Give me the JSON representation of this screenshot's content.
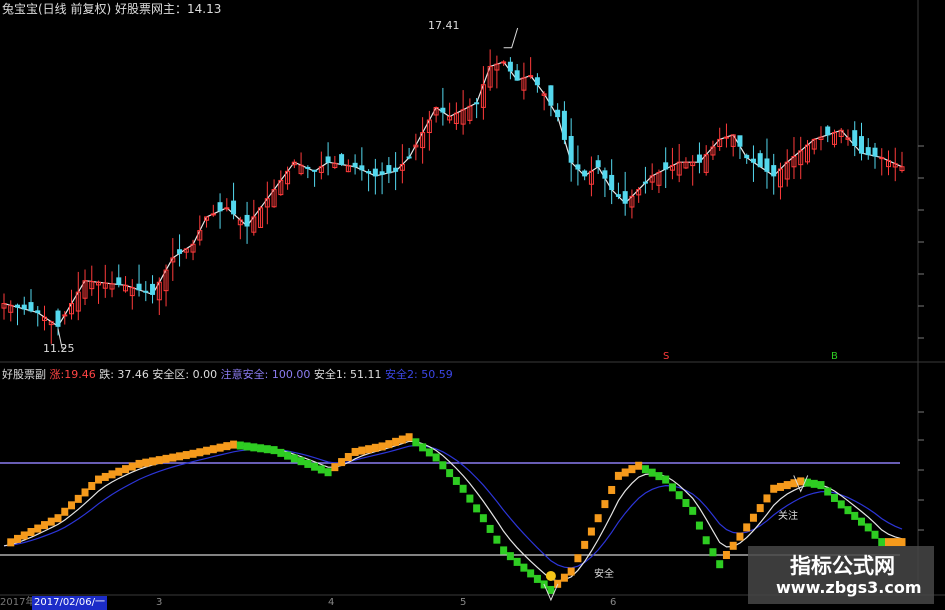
{
  "main_title": "兔宝宝(日线 前复权)  好股票网主：",
  "main_value": "14.13",
  "hi_label": "17.41",
  "lo_label": "11.25",
  "sub_title": "好股票副",
  "ind_zhang_label": "涨:",
  "ind_zhang_value": "19.46",
  "ind_die": "跌: 37.46",
  "ind_anquanqu": "安全区: 0.00",
  "ind_zhuyi": "注意安全: 100.00",
  "ind_anquan1": "安全1: 51.11",
  "ind_anquan2": "安全2: 50.59",
  "mark_b": "B",
  "mark_s": "S",
  "sig_anquan": "安全",
  "sig_guanzhu": "关注",
  "axis_date": "2017/02/06/一",
  "axis_year": "2017年",
  "x_ticks": [
    "3",
    "4",
    "5",
    "6"
  ],
  "watermark_cn": "指标公式网",
  "watermark_url": "www.zbgs3.com",
  "colors": {
    "up": "#ff3b3b",
    "down": "#54d8ee",
    "orange": "#f59a1c",
    "green": "#2ecc22",
    "purple": "#8b7cf0",
    "blue": "#2c35d8"
  },
  "chart_data": {
    "type": "candlestick+indicator",
    "main": {
      "ylim": [
        11.0,
        17.8
      ],
      "close_path": [
        [
          0,
          11.8
        ],
        [
          5,
          11.6
        ],
        [
          8,
          11.3
        ],
        [
          12,
          12.3
        ],
        [
          18,
          12.2
        ],
        [
          22,
          12.0
        ],
        [
          25,
          12.8
        ],
        [
          28,
          13.1
        ],
        [
          30,
          13.7
        ],
        [
          33,
          13.9
        ],
        [
          36,
          13.5
        ],
        [
          40,
          14.3
        ],
        [
          43,
          14.9
        ],
        [
          46,
          14.7
        ],
        [
          48,
          14.9
        ],
        [
          52,
          14.8
        ],
        [
          55,
          14.6
        ],
        [
          58,
          14.7
        ],
        [
          60,
          15.0
        ],
        [
          64,
          16.1
        ],
        [
          66,
          15.9
        ],
        [
          70,
          16.2
        ],
        [
          72,
          17.0
        ],
        [
          74,
          17.1
        ],
        [
          76,
          16.7
        ],
        [
          78,
          16.8
        ],
        [
          80,
          16.4
        ],
        [
          82,
          15.9
        ],
        [
          84,
          14.9
        ],
        [
          86,
          14.6
        ],
        [
          88,
          14.8
        ],
        [
          90,
          14.3
        ],
        [
          92,
          14.0
        ],
        [
          96,
          14.6
        ],
        [
          100,
          14.9
        ],
        [
          103,
          14.9
        ],
        [
          106,
          15.4
        ],
        [
          108,
          15.5
        ],
        [
          110,
          15.0
        ],
        [
          114,
          14.6
        ],
        [
          116,
          14.9
        ],
        [
          120,
          15.4
        ],
        [
          124,
          15.6
        ],
        [
          127,
          15.1
        ],
        [
          130,
          15.0
        ],
        [
          133,
          14.8
        ]
      ],
      "hi_annotation": 17.41,
      "lo_annotation": 11.25
    },
    "indicator": {
      "ylim": [
        0,
        100
      ],
      "levels": {
        "注意安全": 100,
        "安全区": 0
      },
      "values": {
        "涨": 19.46,
        "跌": 37.46,
        "安全区": 0.0,
        "注意安全": 100.0,
        "安全1": 51.11,
        "安全2": 50.59
      },
      "osc_path": [
        [
          0,
          10
        ],
        [
          8,
          40
        ],
        [
          14,
          82
        ],
        [
          20,
          99
        ],
        [
          28,
          110
        ],
        [
          34,
          120
        ],
        [
          40,
          114
        ],
        [
          46,
          96
        ],
        [
          48,
          90
        ],
        [
          52,
          112
        ],
        [
          56,
          118
        ],
        [
          60,
          128
        ],
        [
          64,
          106
        ],
        [
          68,
          72
        ],
        [
          71,
          40
        ],
        [
          74,
          5
        ],
        [
          78,
          -20
        ],
        [
          81,
          -38
        ],
        [
          84,
          -18
        ],
        [
          88,
          40
        ],
        [
          91,
          86
        ],
        [
          94,
          97
        ],
        [
          98,
          82
        ],
        [
          102,
          48
        ],
        [
          104,
          16
        ],
        [
          106,
          -10
        ],
        [
          110,
          30
        ],
        [
          114,
          72
        ],
        [
          118,
          80
        ],
        [
          121,
          76
        ],
        [
          124,
          55
        ],
        [
          128,
          30
        ],
        [
          130,
          14
        ]
      ]
    }
  }
}
